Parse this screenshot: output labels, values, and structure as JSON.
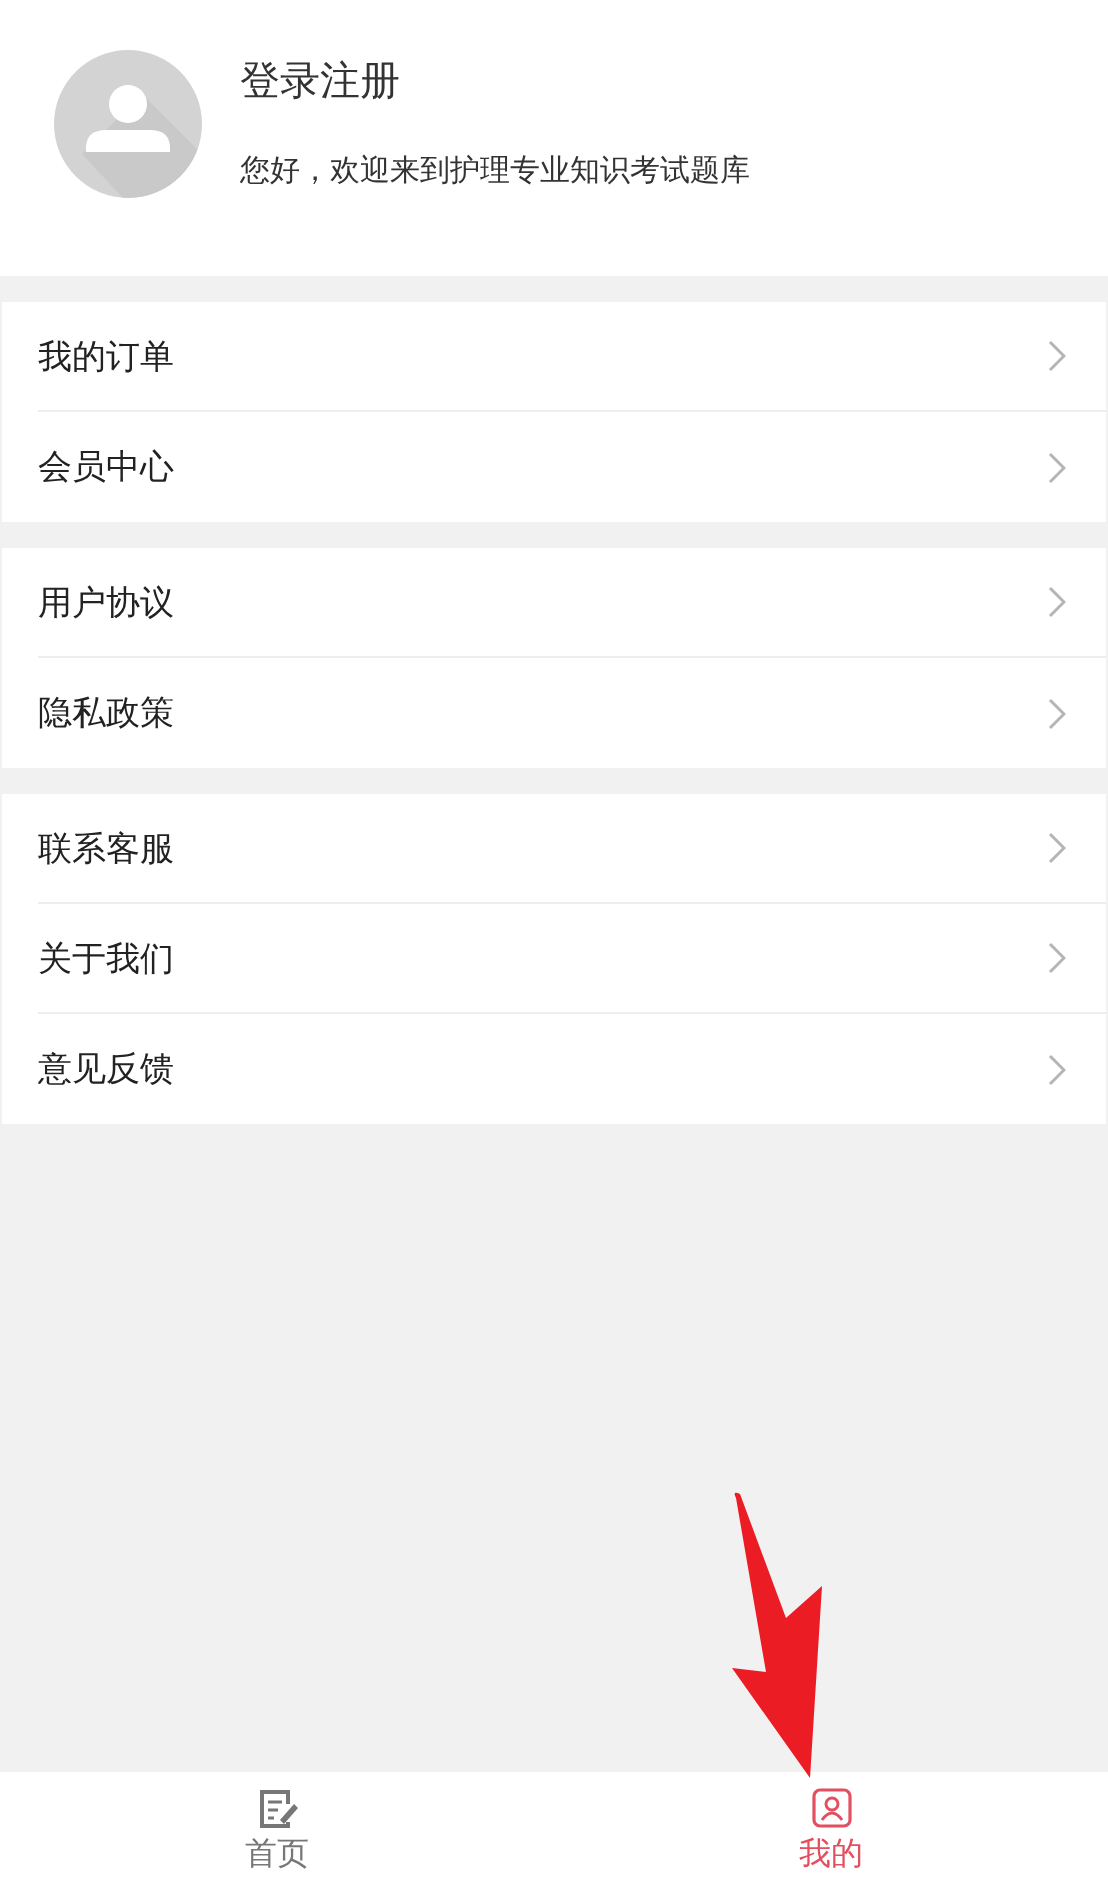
{
  "profile": {
    "title": "登录注册",
    "subtitle": "您好，欢迎来到护理专业知识考试题库"
  },
  "menu_groups": [
    {
      "items": [
        {
          "label": "我的订单"
        },
        {
          "label": "会员中心"
        }
      ]
    },
    {
      "items": [
        {
          "label": "用户协议"
        },
        {
          "label": "隐私政策"
        }
      ]
    },
    {
      "items": [
        {
          "label": "联系客服"
        },
        {
          "label": "关于我们"
        },
        {
          "label": "意见反馈"
        }
      ]
    }
  ],
  "tab_bar": [
    {
      "label": "首页",
      "kind": "home",
      "selected": false
    },
    {
      "label": "我的",
      "kind": "profile",
      "selected": true
    }
  ]
}
